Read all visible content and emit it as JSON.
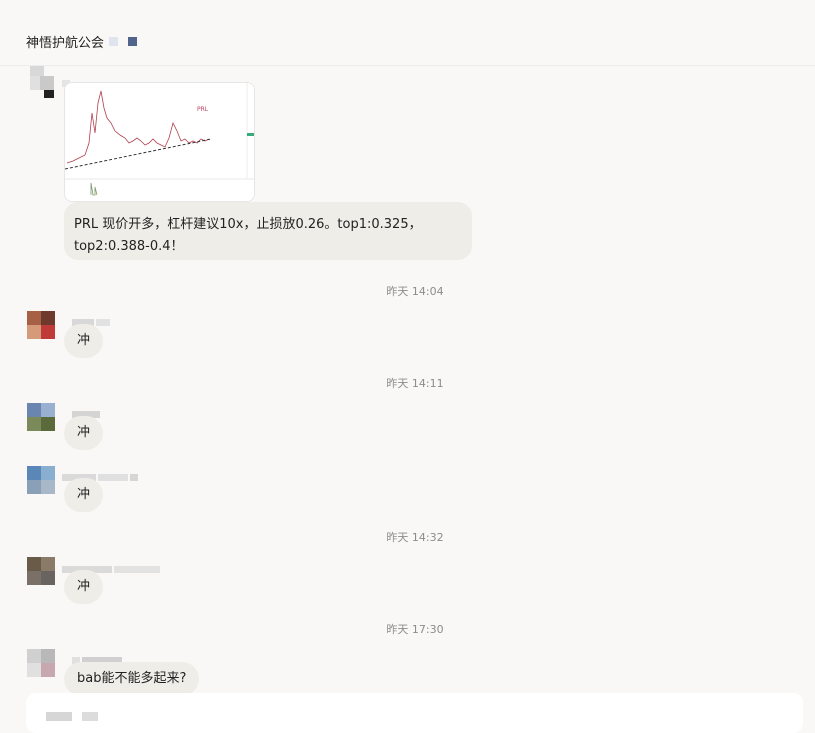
{
  "group": {
    "title": "神悟护航公会"
  },
  "messages": [
    {
      "text": "PRL 现价开多，杠杆建议10x，止损放0.26。top1:0.325，",
      "text2": "top2:0.388-0.4！",
      "chart_label": "PRL"
    },
    {
      "time": "昨天 14:04",
      "text": "冲"
    },
    {
      "time": "昨天 14:11",
      "text": "冲"
    },
    {
      "text": "冲"
    },
    {
      "time": "昨天 14:32",
      "text": "冲"
    },
    {
      "time": "昨天 17:30",
      "text": "bab能不能多起来?"
    }
  ],
  "colors": {
    "background": "#f9f8f6",
    "bubble": "#efede8",
    "timestamp": "#8c8c8c",
    "chart_line": "#b04050",
    "chart_trend": "#333333"
  }
}
